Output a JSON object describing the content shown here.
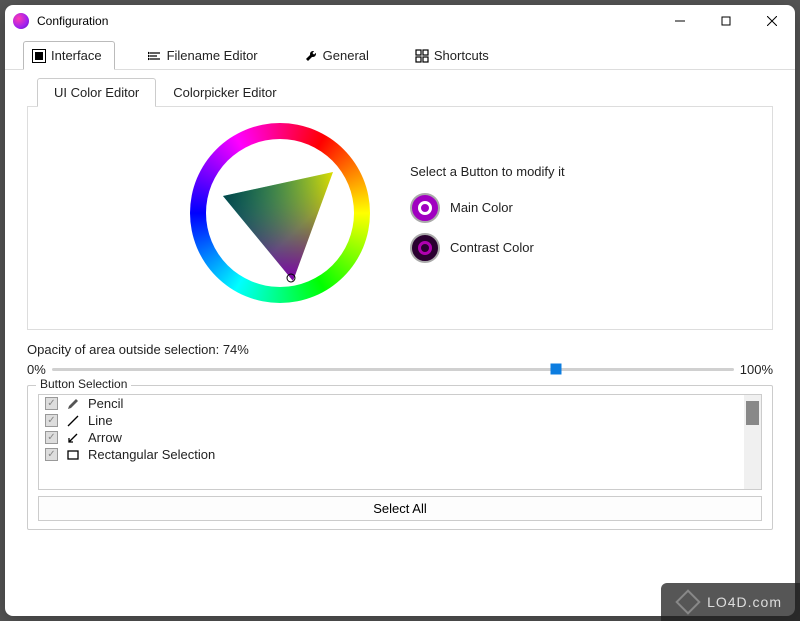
{
  "window": {
    "title": "Configuration"
  },
  "tabs": {
    "interface": "Interface",
    "filename": "Filename Editor",
    "general": "General",
    "shortcuts": "Shortcuts"
  },
  "subtabs": {
    "uicolor": "UI Color Editor",
    "colorpicker": "Colorpicker Editor"
  },
  "picker": {
    "hint": "Select a Button to modify it",
    "main": "Main Color",
    "contrast": "Contrast Color",
    "main_color": "#a000c0",
    "contrast_color": "#2a0030"
  },
  "opacity": {
    "label": "Opacity of area outside selection: 74%",
    "value_percent": 74,
    "min_label": "0%",
    "max_label": "100%"
  },
  "button_selection": {
    "legend": "Button Selection",
    "items": [
      {
        "label": "Pencil"
      },
      {
        "label": "Line"
      },
      {
        "label": "Arrow"
      },
      {
        "label": "Rectangular Selection"
      }
    ],
    "select_all": "Select All"
  },
  "watermark": "LO4D.com"
}
